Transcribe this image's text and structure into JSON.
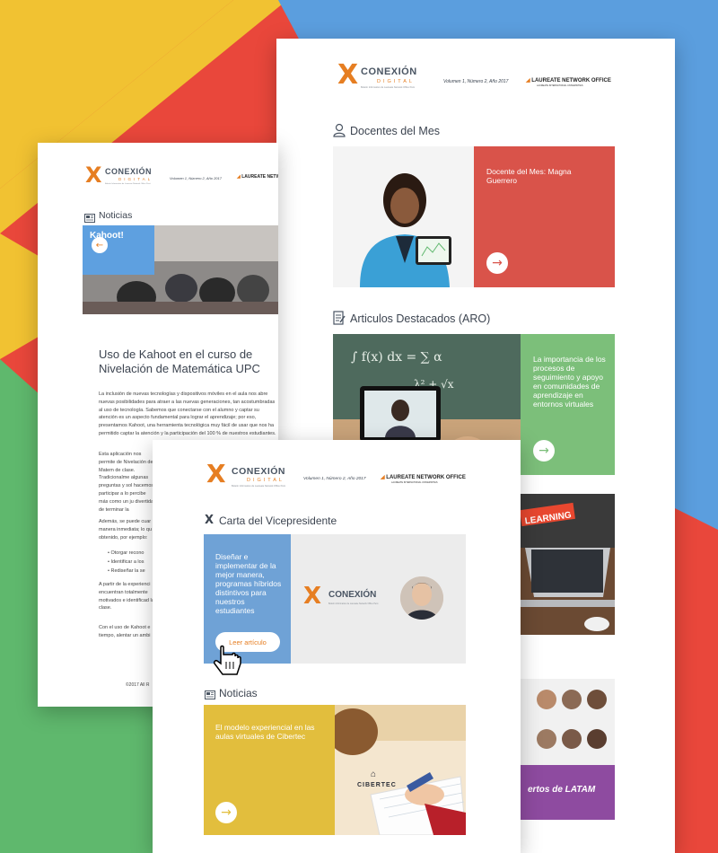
{
  "brand": {
    "name": "CONEXIÓN",
    "sub": "DIGITAL",
    "tagline": "Boletín Informativo de Laureate Network Office Perú",
    "volume": "Volumen 1, Número 2, Año 2017",
    "partner": "LAUREATE NETWORK OFFICE",
    "partner_sub": "LAUREATE INTERNATIONAL UNIVERSITIES"
  },
  "right_page": {
    "section_docentes": "Docentes del Mes",
    "docente_title": "Docente del Mes: Magna Guerrero",
    "section_articulos": "Articulos Destacados (ARO)",
    "articulo_title": "La importancia de los procesos de seguimiento y apoyo en comunidades de aprendizaje en entornos virtuales",
    "elearning_label": "LEARNING",
    "expertos_label": "ertos de LATAM"
  },
  "left_page": {
    "section_noticias": "Noticias",
    "slide_label": "Kahoot!",
    "article_title": "Uso de Kahoot en el curso de Nivelación de Matemática UPC",
    "paragraphs": [
      "La inclusión de nuevas tecnologías y dispositivos móviles en el aula nos abre nuevas posibilidades para atraer a las nuevas generaciones, tan acostumbradas al uso de tecnología. Sabemos que conectarse con el alumno y captar su atención es un aspecto fundamental para lograr el aprendizaje; por eso, presentamos Kahoot, una herramienta tecnológica muy fácil de usar que nos ha permitido captar la atención y la participación del 100 % de nuestros estudiantes.",
      "Esta aplicación nos permite de Nivelación de Matem de clase. Tradicionalme algunas preguntas y sol hacemos participar a lo percibe más como un ju divertida de terminar la",
      "Además, se puede cuar manera inmediata; lo qu obtenido, por ejemplo:",
      "A partir de la experienci encuentran totalmente motivados e identificad la clase.",
      "Con el uso de Kahoot e tiempo, alentar un ambi"
    ],
    "bullets": [
      "Otorgar recono",
      "Identificar a los",
      "Rediseñar la se"
    ],
    "footer": "©2017 All R"
  },
  "front_page": {
    "section_carta": "Carta del Vicepresidente",
    "carta_text": "Diseñar e implementar de la mejor manera, programas híbridos distintivos para nuestros estudiantes",
    "read_button": "Leer artículo",
    "section_noticias": "Noticias",
    "noticia_title": "El modelo experiencial en las aulas virtuales de Cibertec",
    "cibertec_label": "CIBERTEC"
  },
  "colors": {
    "red_tile": "#d9534a",
    "green_tile": "#7cbf7a",
    "blue_tile": "#6fa2d6",
    "yellow_tile": "#e2be3d",
    "purple_tile": "#8e4ba0",
    "accent_orange": "#e67e22"
  }
}
